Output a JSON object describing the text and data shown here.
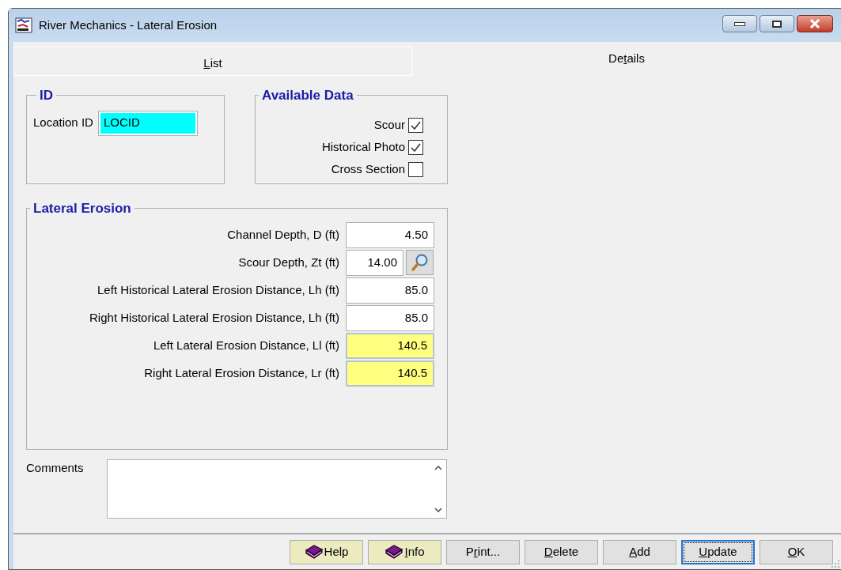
{
  "window": {
    "title": "River Mechanics - Lateral Erosion"
  },
  "tabs": [
    {
      "label": [
        {
          "text": "L",
          "underlined": true
        },
        {
          "text": "ist",
          "underlined": false
        }
      ],
      "selected": false
    },
    {
      "label": [
        {
          "text": "De",
          "underlined": false
        },
        {
          "text": "t",
          "underlined": true
        },
        {
          "text": "ails",
          "underlined": false
        }
      ],
      "selected": true
    }
  ],
  "id_group": {
    "title": "ID",
    "label": "Location ID",
    "value": "LOCID"
  },
  "available_data": {
    "title": "Available Data",
    "items": [
      {
        "label": "Scour",
        "checked": true
      },
      {
        "label": "Historical Photo",
        "checked": true
      },
      {
        "label": "Cross Section",
        "checked": false
      }
    ]
  },
  "lateral_erosion": {
    "title": "Lateral Erosion",
    "fields": [
      {
        "label": "Channel Depth, D (ft)",
        "value": "4.50",
        "kind": "input"
      },
      {
        "label": "Scour Depth, Zt (ft)",
        "value": "14.00",
        "kind": "lookup"
      },
      {
        "label": "Left Historical Lateral Erosion Distance, Lh (ft)",
        "value": "85.0",
        "kind": "input"
      },
      {
        "label": "Right Historical Lateral Erosion Distance, Lh (ft)",
        "value": "85.0",
        "kind": "input"
      },
      {
        "label": "Left Lateral Erosion Distance, Ll (ft)",
        "value": "140.5",
        "kind": "computed"
      },
      {
        "label": "Right Lateral Erosion Distance, Lr (ft)",
        "value": "140.5",
        "kind": "computed"
      }
    ]
  },
  "comments": {
    "label": "Comments"
  },
  "buttons": [
    {
      "label": [
        {
          "text": "Help",
          "underlined": false
        }
      ],
      "kind": "book",
      "focused": false
    },
    {
      "label": [
        {
          "text": "I",
          "underlined": true
        },
        {
          "text": "nfo",
          "underlined": false
        }
      ],
      "kind": "book",
      "focused": false
    },
    {
      "label": [
        {
          "text": "P",
          "underlined": false
        },
        {
          "text": "r",
          "underlined": true
        },
        {
          "text": "int...",
          "underlined": false
        }
      ],
      "kind": "plain",
      "focused": false
    },
    {
      "label": [
        {
          "text": "D",
          "underlined": true
        },
        {
          "text": "elete",
          "underlined": false
        }
      ],
      "kind": "plain",
      "focused": false
    },
    {
      "label": [
        {
          "text": "A",
          "underlined": true
        },
        {
          "text": "dd",
          "underlined": false
        }
      ],
      "kind": "plain",
      "focused": false
    },
    {
      "label": [
        {
          "text": "U",
          "underlined": true
        },
        {
          "text": "pdate",
          "underlined": false
        }
      ],
      "kind": "plain",
      "focused": true
    },
    {
      "label": [
        {
          "text": "O",
          "underlined": true
        },
        {
          "text": "K",
          "underlined": false
        }
      ],
      "kind": "plain",
      "focused": false
    }
  ]
}
